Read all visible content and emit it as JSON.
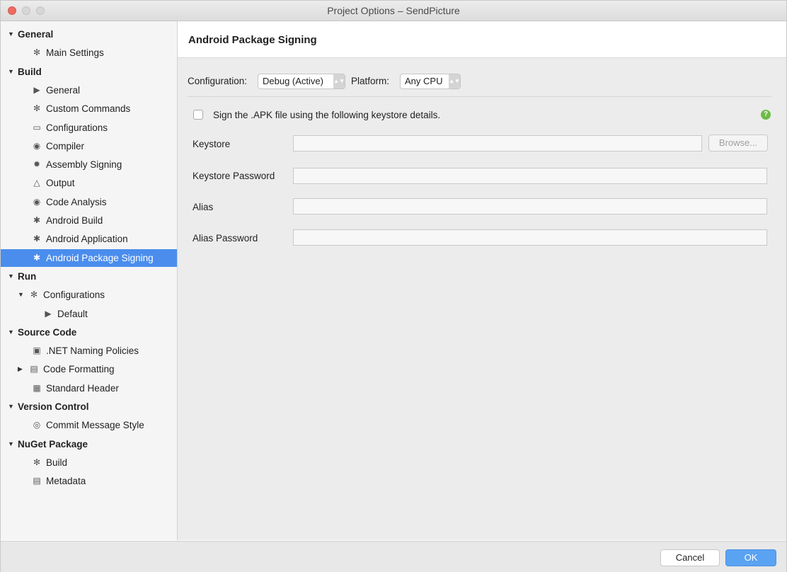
{
  "window": {
    "title": "Project Options – SendPicture"
  },
  "sidebar": {
    "items": [
      {
        "label": "General",
        "level": 0,
        "expanded": true,
        "icon": ""
      },
      {
        "label": "Main Settings",
        "level": 1,
        "icon": "gear-icon"
      },
      {
        "label": "Build",
        "level": 0,
        "expanded": true,
        "icon": ""
      },
      {
        "label": "General",
        "level": 1,
        "icon": "run-icon"
      },
      {
        "label": "Custom Commands",
        "level": 1,
        "icon": "gear-icon"
      },
      {
        "label": "Configurations",
        "level": 1,
        "icon": "window-icon"
      },
      {
        "label": "Compiler",
        "level": 1,
        "icon": "compiler-icon"
      },
      {
        "label": "Assembly Signing",
        "level": 1,
        "icon": "seal-icon"
      },
      {
        "label": "Output",
        "level": 1,
        "icon": "flask-icon"
      },
      {
        "label": "Code Analysis",
        "level": 1,
        "icon": "target-icon"
      },
      {
        "label": "Android Build",
        "level": 1,
        "icon": "android-icon"
      },
      {
        "label": "Android Application",
        "level": 1,
        "icon": "android-icon"
      },
      {
        "label": "Android Package Signing",
        "level": 1,
        "icon": "android-icon",
        "selected": true
      },
      {
        "label": "Run",
        "level": 0,
        "expanded": true,
        "icon": ""
      },
      {
        "label": "Configurations",
        "level": 1,
        "expanded": true,
        "icon": "gear-icon"
      },
      {
        "label": "Default",
        "level": 2,
        "icon": "play-icon"
      },
      {
        "label": "Source Code",
        "level": 0,
        "expanded": true,
        "icon": ""
      },
      {
        "label": ".NET Naming Policies",
        "level": 1,
        "icon": "naming-icon"
      },
      {
        "label": "Code Formatting",
        "level": 1,
        "collapsed": true,
        "icon": "format-icon"
      },
      {
        "label": "Standard Header",
        "level": 1,
        "icon": "header-icon"
      },
      {
        "label": "Version Control",
        "level": 0,
        "expanded": true,
        "icon": ""
      },
      {
        "label": "Commit Message Style",
        "level": 1,
        "icon": "commit-icon"
      },
      {
        "label": "NuGet Package",
        "level": 0,
        "expanded": true,
        "icon": ""
      },
      {
        "label": "Build",
        "level": 1,
        "icon": "gear-icon"
      },
      {
        "label": "Metadata",
        "level": 1,
        "icon": "document-icon"
      }
    ]
  },
  "panel": {
    "title": "Android Package Signing",
    "configuration_label": "Configuration:",
    "configuration_value": "Debug (Active)",
    "platform_label": "Platform:",
    "platform_value": "Any CPU",
    "sign_checkbox_label": "Sign the .APK file using the following keystore details.",
    "sign_checked": false,
    "help_glyph": "?",
    "keystore_label": "Keystore",
    "keystore_value": "",
    "browse_label": "Browse...",
    "keystore_password_label": "Keystore Password",
    "keystore_password_value": "",
    "alias_label": "Alias",
    "alias_value": "",
    "alias_password_label": "Alias Password",
    "alias_password_value": ""
  },
  "footer": {
    "cancel_label": "Cancel",
    "ok_label": "OK"
  },
  "colors": {
    "selection": "#4a8ded",
    "ok_button": "#5aa2f2",
    "help": "#6dbb46",
    "close": "#ee6a5f"
  }
}
